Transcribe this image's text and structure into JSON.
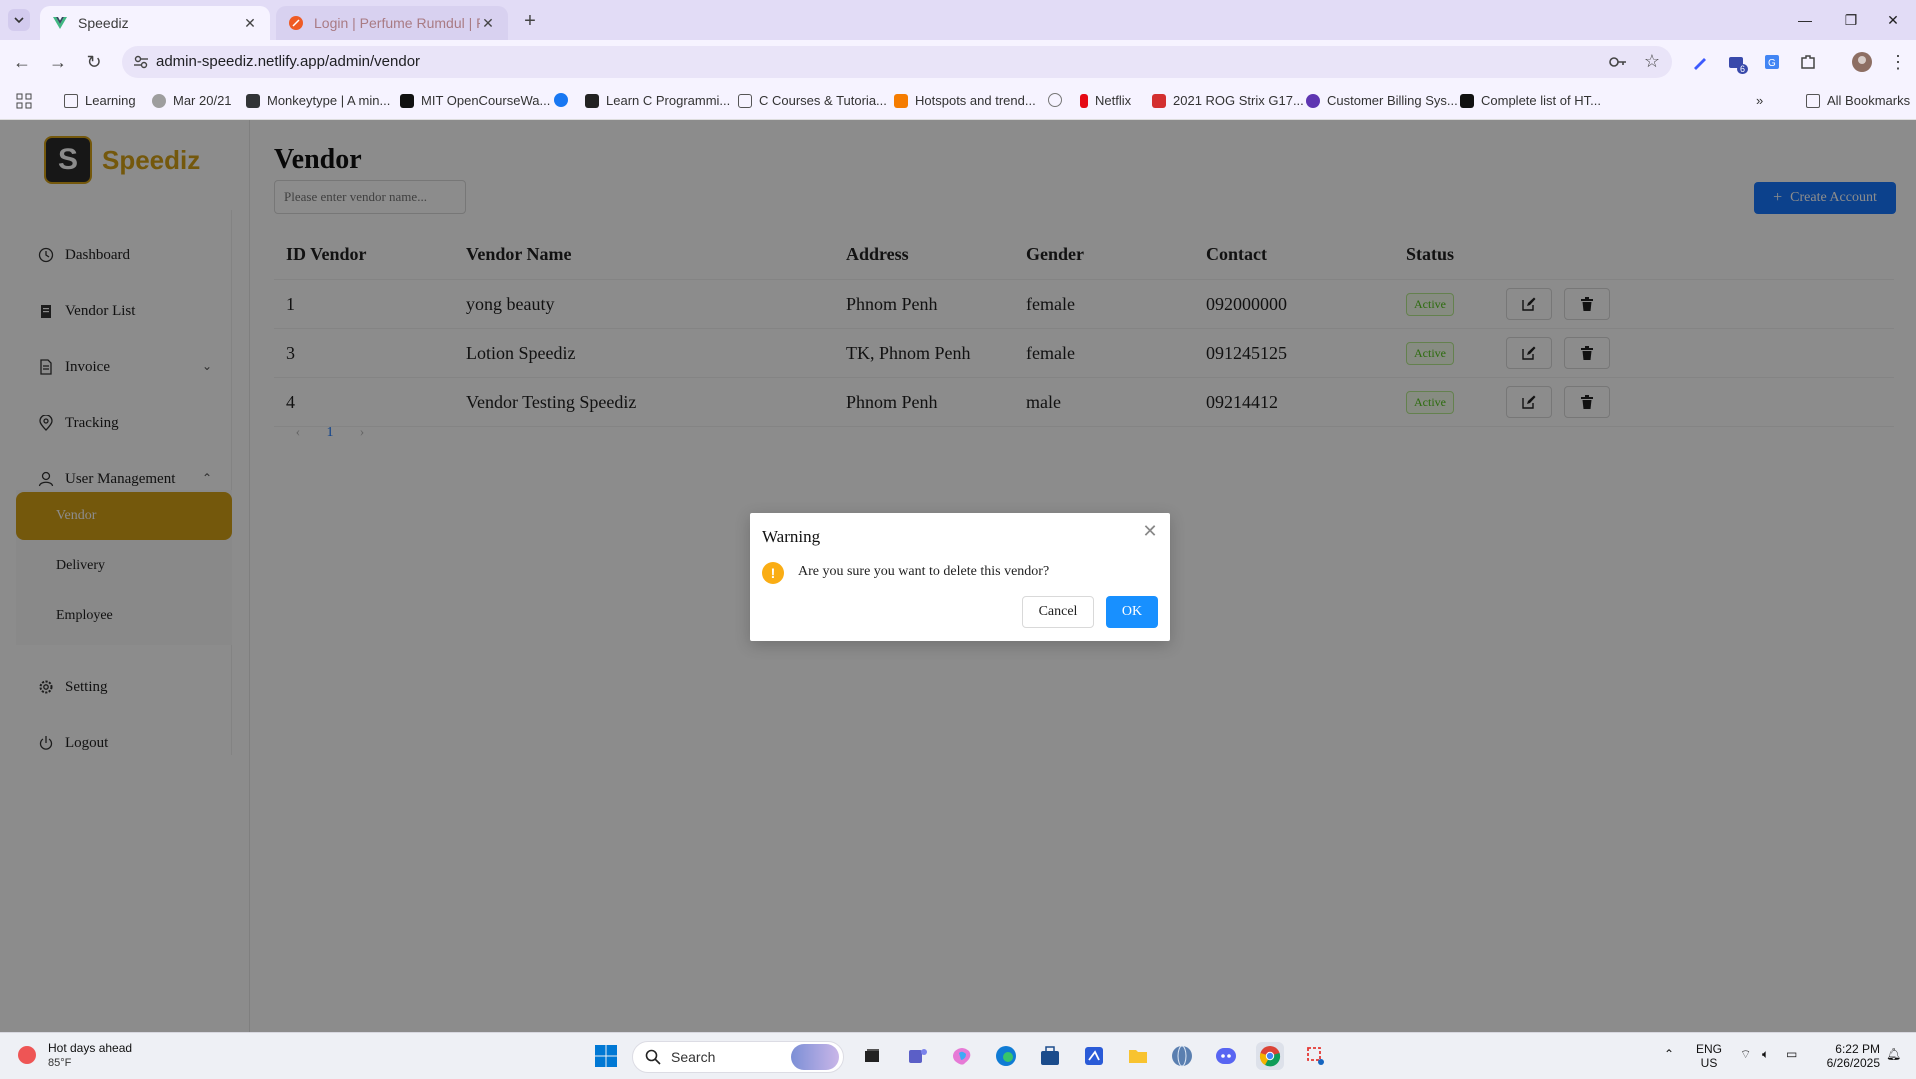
{
  "browser": {
    "tabs": [
      {
        "title": "Speediz",
        "active": true
      },
      {
        "title": "Login | Perfume Rumdul | Postm",
        "active": false
      }
    ],
    "url": "admin-speediz.netlify.app/admin/vendor",
    "ext_badge": "6",
    "bookmarks": [
      "Learning",
      "Mar 20/21",
      "Monkeytype | A min...",
      "MIT OpenCourseWa...",
      "",
      "Learn C Programmi...",
      "C Courses & Tutoria...",
      "Hotspots and trend...",
      "",
      "Netflix",
      "2021 ROG Strix G17...",
      "Customer Billing Sys...",
      "Complete list of HT..."
    ],
    "all_bookmarks": "All Bookmarks"
  },
  "app": {
    "logo_letter": "S",
    "logo_text": "Speediz",
    "menu": {
      "dashboard": "Dashboard",
      "vendor_list": "Vendor List",
      "invoice": "Invoice",
      "tracking": "Tracking",
      "user_management": "User Management",
      "setting": "Setting",
      "logout": "Logout"
    },
    "submenu": {
      "vendor": "Vendor",
      "delivery": "Delivery",
      "employee": "Employee"
    },
    "page_title": "Vendor",
    "search_placeholder": "Please enter vendor name...",
    "create_button": "Create Account",
    "table": {
      "headers": [
        "ID Vendor",
        "Vendor Name",
        "Address",
        "Gender",
        "Contact",
        "Status"
      ],
      "rows": [
        {
          "id": "1",
          "name": "yong beauty",
          "address": "Phnom Penh",
          "gender": "female",
          "contact": "092000000",
          "status": "Active"
        },
        {
          "id": "3",
          "name": "Lotion Speediz",
          "address": "TK, Phnom Penh",
          "gender": "female",
          "contact": "091245125",
          "status": "Active"
        },
        {
          "id": "4",
          "name": "Vendor Testing Speediz",
          "address": "Phnom Penh",
          "gender": "male",
          "contact": "09214412",
          "status": "Active"
        }
      ]
    },
    "pagination": {
      "prev": "‹",
      "current": "1",
      "next": "›"
    }
  },
  "modal": {
    "title": "Warning",
    "message": "Are you sure you want to delete this vendor?",
    "cancel": "Cancel",
    "ok": "OK"
  },
  "taskbar": {
    "weather_line1": "Hot days ahead",
    "weather_line2": "85°F",
    "search": "Search",
    "lang1": "ENG",
    "lang2": "US",
    "time": "6:22 PM",
    "date": "6/26/2025"
  },
  "colors": {
    "brand": "#d4a017",
    "primary": "#1677ff",
    "success": "#52c41a",
    "warning": "#faad14"
  }
}
